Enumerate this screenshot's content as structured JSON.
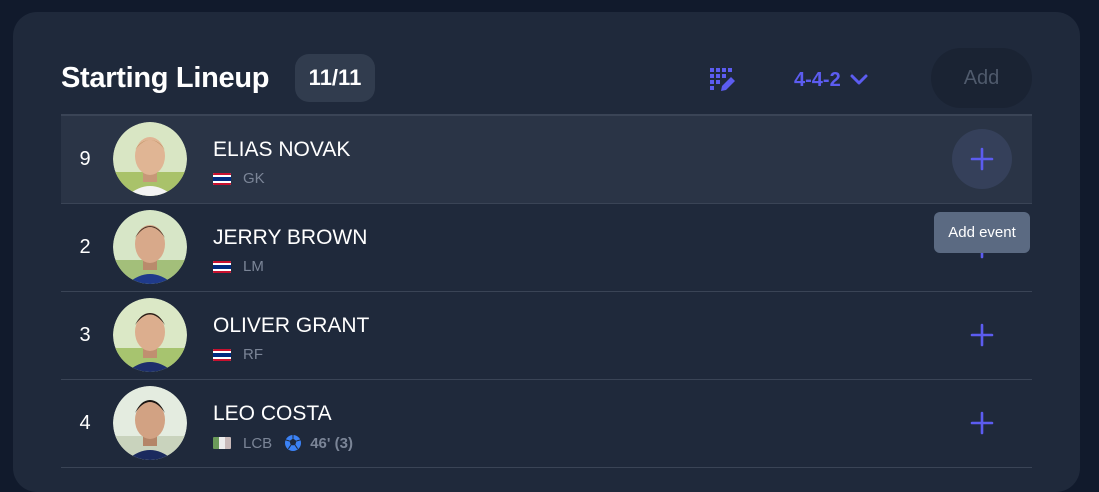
{
  "header": {
    "title": "Starting Lineup",
    "count": "11/11",
    "formation_icon": "formation-edit-icon",
    "formation": "4-4-2",
    "add_label": "Add"
  },
  "players": [
    {
      "number": "9",
      "name": "ELIAS NOVAK",
      "position": "GK",
      "flag": "flag-stripes-red-white-blue",
      "goal": ""
    },
    {
      "number": "2",
      "name": "JERRY BROWN",
      "position": "LM",
      "flag": "flag-stripes-red-white-blue",
      "goal": ""
    },
    {
      "number": "3",
      "name": "OLIVER GRANT",
      "position": "RF",
      "flag": "flag-stripes-red-white-blue",
      "goal": ""
    },
    {
      "number": "4",
      "name": "LEO COSTA",
      "position": "LCB",
      "flag": "flag-green-white-red",
      "goal": "46' (3)"
    }
  ],
  "tooltip": "Add event",
  "colors": {
    "accent": "#5c5cf0",
    "card": "#1f293b",
    "background": "#111a2c",
    "row_highlight": "#2a3446"
  }
}
